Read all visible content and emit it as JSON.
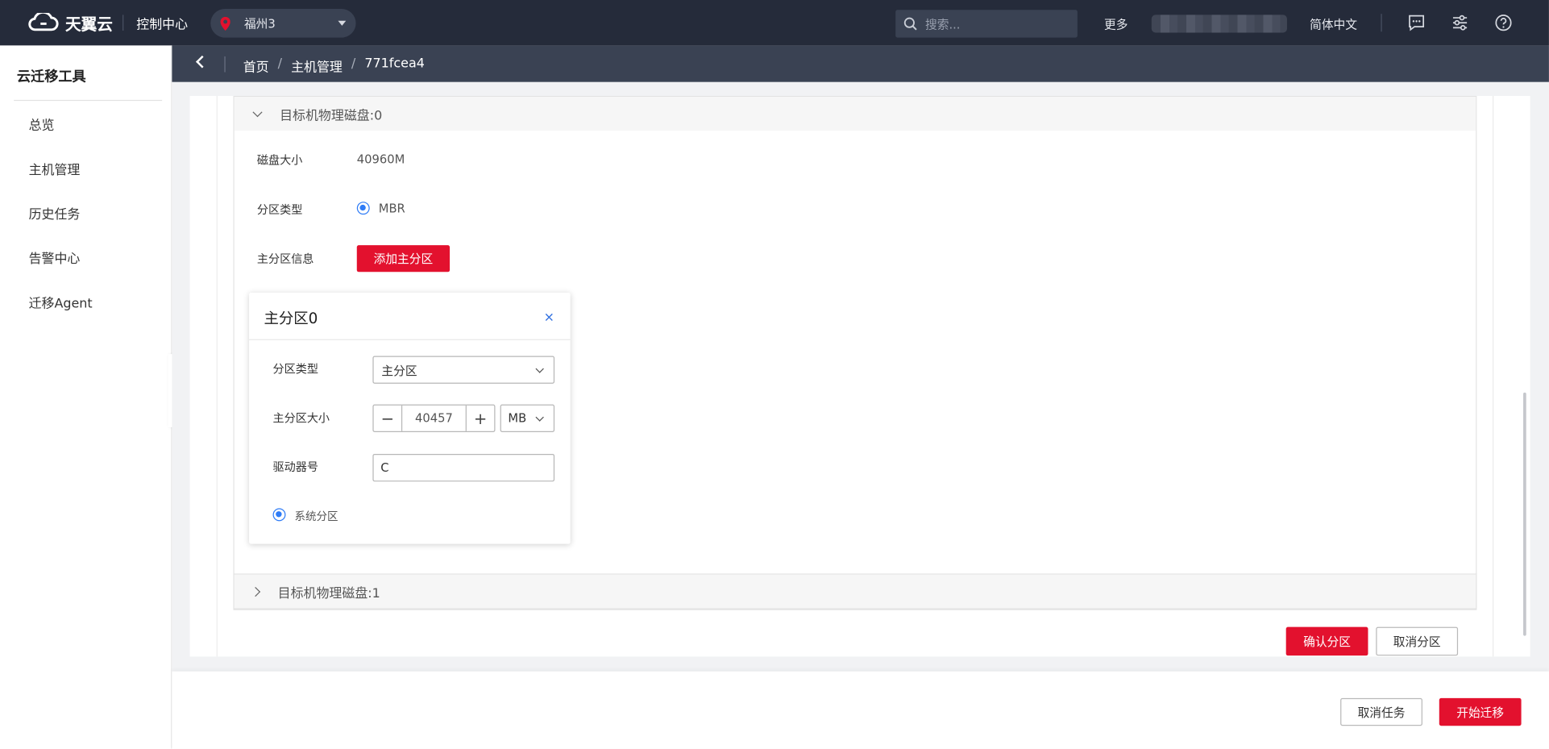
{
  "header": {
    "brand": "天翼云",
    "console": "控制中心",
    "region": "福州3",
    "search_placeholder": "搜索...",
    "more": "更多",
    "language": "简体中文"
  },
  "breadcrumb": {
    "items": [
      "首页",
      "主机管理",
      "771fcea4"
    ]
  },
  "sidebar": {
    "title": "云迁移工具",
    "items": [
      {
        "label": "总览"
      },
      {
        "label": "主机管理"
      },
      {
        "label": "历史任务"
      },
      {
        "label": "告警中心"
      },
      {
        "label": "迁移Agent"
      }
    ]
  },
  "disk0": {
    "title": "目标机物理磁盘:0",
    "size_label": "磁盘大小",
    "size_value": "40960M",
    "partition_type_label": "分区类型",
    "partition_type_value": "MBR",
    "primary_info_label": "主分区信息",
    "add_primary_button": "添加主分区"
  },
  "partition_card": {
    "title": "主分区0",
    "close": "×",
    "type_label": "分区类型",
    "type_value": "主分区",
    "size_label": "主分区大小",
    "size_value": "40457",
    "minus": "−",
    "plus": "+",
    "unit": "MB",
    "drive_label": "驱动器号",
    "drive_value": "C",
    "system_partition_label": "系统分区"
  },
  "disk1": {
    "title": "目标机物理磁盘:1"
  },
  "actions": {
    "confirm_partition": "确认分区",
    "cancel_partition": "取消分区",
    "cancel_task": "取消任务",
    "start_migration": "开始迁移"
  },
  "colors": {
    "topbar": "#252b3a",
    "breadcrumb_bar": "#3a4253",
    "accent_red": "#e3112e",
    "radio_blue": "#2f7cf6"
  }
}
